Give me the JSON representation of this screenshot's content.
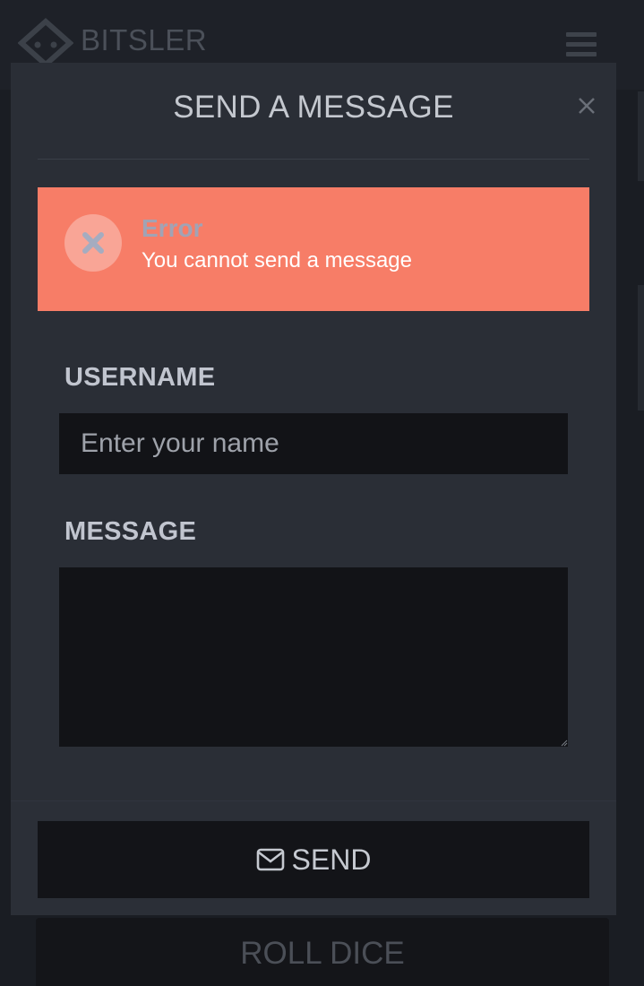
{
  "app": {
    "brand": "BITSLER"
  },
  "background": {
    "roll_dice_label": "ROLL DICE"
  },
  "modal": {
    "title": "SEND A MESSAGE",
    "close_icon": "close-icon",
    "alert": {
      "icon": "x-circle-icon",
      "title": "Error",
      "text": "You cannot send a message",
      "color": "#f77d67"
    },
    "form": {
      "username_label": "USERNAME",
      "username_placeholder": "Enter your name",
      "username_value": "",
      "message_label": "MESSAGE",
      "message_value": ""
    },
    "send_button": {
      "icon": "envelope-icon",
      "label": "SEND"
    }
  },
  "colors": {
    "page_bg": "#1a1d23",
    "modal_bg": "#2a2e36",
    "input_bg": "#121317",
    "error": "#f77d67"
  }
}
